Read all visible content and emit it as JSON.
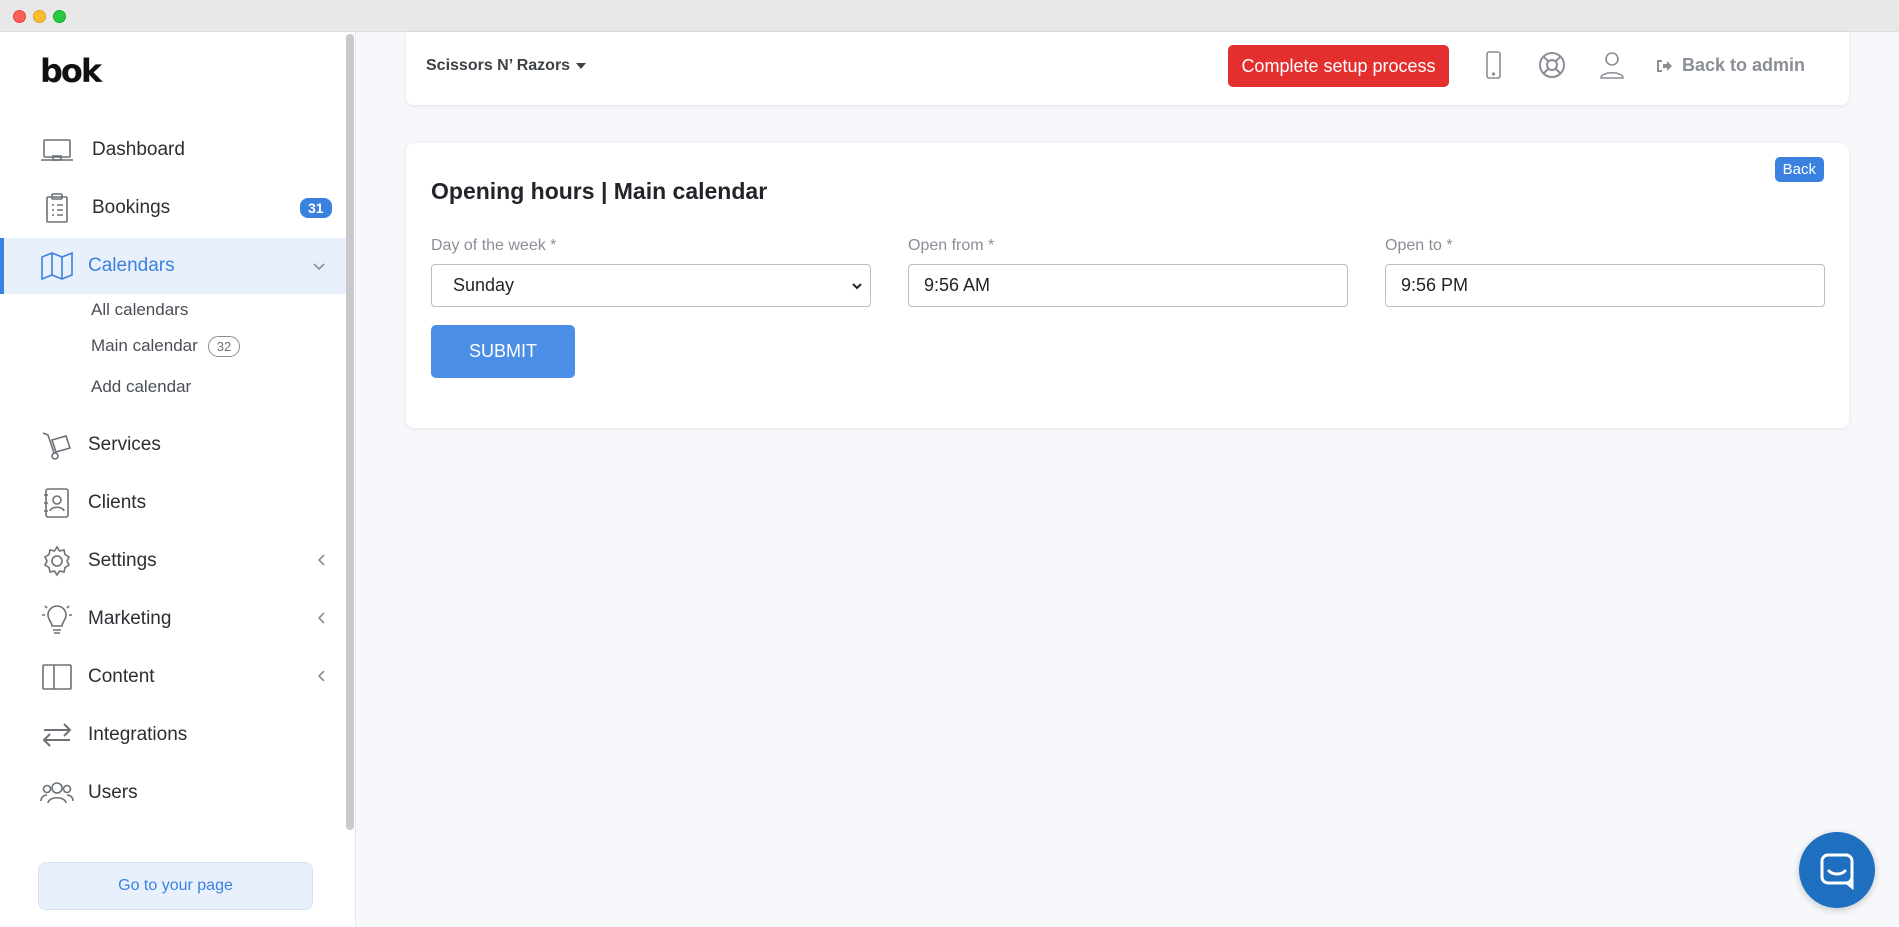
{
  "sidebar": {
    "logo": "bok",
    "items": [
      {
        "label": "Dashboard",
        "icon": "laptop-icon"
      },
      {
        "label": "Bookings",
        "icon": "clipboard-icon",
        "badge": "31"
      },
      {
        "label": "Calendars",
        "icon": "map-icon",
        "active": true
      },
      {
        "label": "Services",
        "icon": "trolley-icon"
      },
      {
        "label": "Clients",
        "icon": "contact-book-icon"
      },
      {
        "label": "Settings",
        "icon": "gear-icon"
      },
      {
        "label": "Marketing",
        "icon": "lightbulb-icon"
      },
      {
        "label": "Content",
        "icon": "columns-icon"
      },
      {
        "label": "Integrations",
        "icon": "arrows-exchange-icon"
      },
      {
        "label": "Users",
        "icon": "users-icon"
      }
    ],
    "calendar_sub": {
      "all": "All calendars",
      "main": "Main calendar",
      "main_count": "32",
      "add": "Add calendar"
    },
    "go_page": "Go to your page"
  },
  "topbar": {
    "shop_name": "Scissors N’ Razors",
    "setup_button": "Complete setup process",
    "back_admin": "Back to admin"
  },
  "card": {
    "title": "Opening hours | Main calendar",
    "back": "Back",
    "fields": {
      "day_label": "Day of the week *",
      "day_value": "Sunday",
      "from_label": "Open from *",
      "from_value": "9:56 AM",
      "to_label": "Open to *",
      "to_value": "9:56 PM"
    },
    "submit": "SUBMIT"
  },
  "colors": {
    "accent": "#3b82e0",
    "danger": "#e3302f",
    "chat": "#1f6fc1"
  }
}
